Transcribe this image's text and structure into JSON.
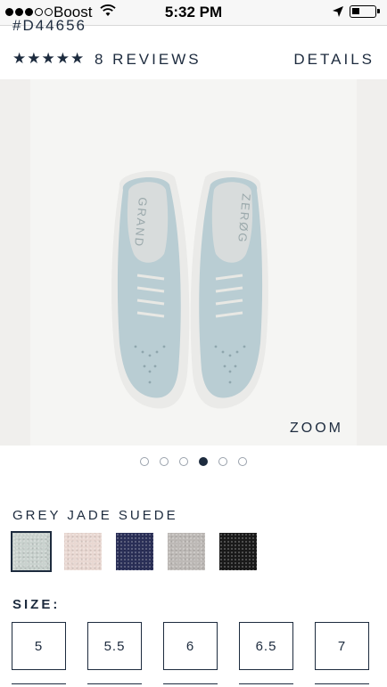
{
  "status_bar": {
    "carrier": "Boost",
    "time": "5:32 PM"
  },
  "product": {
    "sku": "#D44656",
    "stars": "★★★★★",
    "reviews_label": "8 REVIEWS",
    "details_label": "DETAILS",
    "zoom_label": "ZOOM",
    "gallery_page_count": 6,
    "gallery_active_index": 3
  },
  "color": {
    "selected_name": "GREY JADE SUEDE",
    "swatches": [
      {
        "name": "grey-jade",
        "color": "#c9d2ce"
      },
      {
        "name": "blush",
        "color": "#e9d8d2"
      },
      {
        "name": "navy",
        "color": "#2a2f57"
      },
      {
        "name": "grey",
        "color": "#bdb9b6"
      },
      {
        "name": "black",
        "color": "#1a1a1a"
      }
    ]
  },
  "size": {
    "label": "SIZE:",
    "options": [
      "5",
      "5.5",
      "6",
      "6.5",
      "7"
    ]
  },
  "colors": {
    "brand_navy": "#1d2b3e"
  }
}
